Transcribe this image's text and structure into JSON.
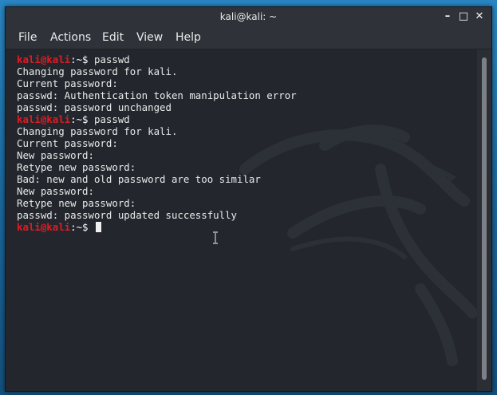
{
  "window": {
    "title": "kali@kali: ~",
    "controls": {
      "minimize": "–",
      "maximize": "□",
      "close": "✕"
    }
  },
  "menu": {
    "file": "File",
    "actions": "Actions",
    "edit": "Edit",
    "view": "View",
    "help": "Help"
  },
  "terminal": {
    "prompt_user": "kali@kali",
    "prompt_path": ":~$",
    "lines": [
      {
        "type": "prompt",
        "command": " passwd"
      },
      {
        "type": "output",
        "text": "Changing password for kali."
      },
      {
        "type": "output",
        "text": "Current password:"
      },
      {
        "type": "output",
        "text": "passwd: Authentication token manipulation error"
      },
      {
        "type": "output",
        "text": "passwd: password unchanged"
      },
      {
        "type": "prompt",
        "command": " passwd"
      },
      {
        "type": "output",
        "text": "Changing password for kali."
      },
      {
        "type": "output",
        "text": "Current password:"
      },
      {
        "type": "output",
        "text": "New password:"
      },
      {
        "type": "output",
        "text": "Retype new password:"
      },
      {
        "type": "output",
        "text": "Bad: new and old password are too similar"
      },
      {
        "type": "output",
        "text": "New password:"
      },
      {
        "type": "output",
        "text": "Retype new password:"
      },
      {
        "type": "output",
        "text": "passwd: password updated successfully"
      },
      {
        "type": "prompt",
        "command": " ",
        "cursor": true
      }
    ]
  },
  "colors": {
    "prompt_user": "#e01b24",
    "background": "#23272d",
    "foreground": "#e9e9e9"
  }
}
